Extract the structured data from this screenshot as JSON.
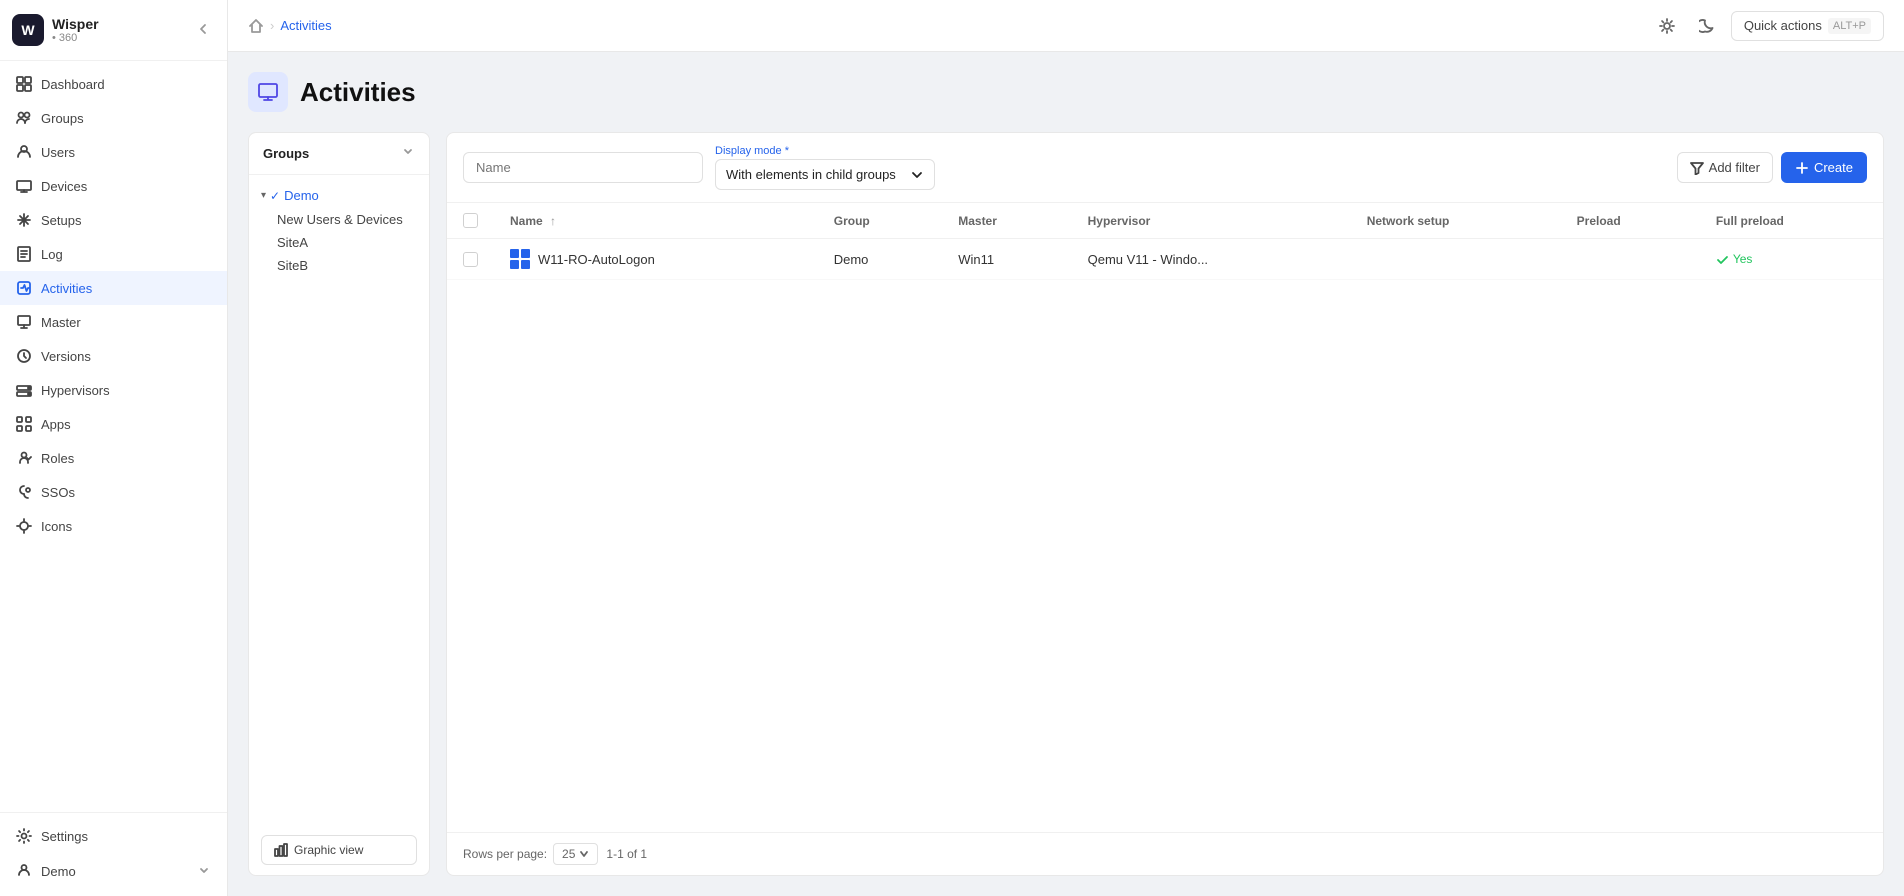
{
  "app": {
    "name": "Wisper",
    "version": "360"
  },
  "sidebar": {
    "items": [
      {
        "label": "Dashboard",
        "icon": "dashboard-icon",
        "active": false
      },
      {
        "label": "Groups",
        "icon": "groups-icon",
        "active": false
      },
      {
        "label": "Users",
        "icon": "users-icon",
        "active": false
      },
      {
        "label": "Devices",
        "icon": "devices-icon",
        "active": false
      },
      {
        "label": "Setups",
        "icon": "setups-icon",
        "active": false
      },
      {
        "label": "Log",
        "icon": "log-icon",
        "active": false
      },
      {
        "label": "Activities",
        "icon": "activities-icon",
        "active": true
      },
      {
        "label": "Master",
        "icon": "master-icon",
        "active": false
      },
      {
        "label": "Versions",
        "icon": "versions-icon",
        "active": false
      },
      {
        "label": "Hypervisors",
        "icon": "hypervisors-icon",
        "active": false
      },
      {
        "label": "Apps",
        "icon": "apps-icon",
        "active": false
      },
      {
        "label": "Roles",
        "icon": "roles-icon",
        "active": false
      },
      {
        "label": "SSOs",
        "icon": "ssos-icon",
        "active": false
      },
      {
        "label": "Icons",
        "icon": "icons-icon",
        "active": false
      }
    ],
    "bottom": [
      {
        "label": "Settings",
        "icon": "settings-icon"
      },
      {
        "label": "Demo",
        "icon": "user-icon"
      }
    ]
  },
  "topbar": {
    "breadcrumb_home": "home",
    "breadcrumb_separator": ">",
    "breadcrumb_current": "Activities",
    "quick_actions_label": "Quick actions",
    "quick_actions_shortcut": "ALT+P"
  },
  "page": {
    "title": "Activities",
    "icon": "monitor-icon"
  },
  "left_panel": {
    "title": "Groups",
    "items": [
      {
        "label": "Demo",
        "selected": true,
        "expanded": true
      },
      {
        "label": "New Users & Devices",
        "child": true
      },
      {
        "label": "SiteA",
        "child": true
      },
      {
        "label": "SiteB",
        "child": true
      }
    ],
    "graphic_view_label": "Graphic view"
  },
  "filter_bar": {
    "name_placeholder": "Name",
    "display_mode_label": "Display mode",
    "display_mode_required": "*",
    "display_mode_value": "With elements in child groups",
    "add_filter_label": "Add filter",
    "create_label": "Create"
  },
  "table": {
    "columns": [
      {
        "label": "Name",
        "sortable": true,
        "sort_dir": "asc"
      },
      {
        "label": "Group"
      },
      {
        "label": "Master"
      },
      {
        "label": "Hypervisor"
      },
      {
        "label": "Network setup"
      },
      {
        "label": "Preload"
      },
      {
        "label": "Full preload"
      }
    ],
    "rows": [
      {
        "name": "W11-RO-AutoLogon",
        "group": "Demo",
        "master": "Win11",
        "hypervisor": "Qemu V11 - Windo...",
        "network_setup": "",
        "preload": "",
        "full_preload": "Yes",
        "full_preload_checked": true
      }
    ],
    "rows_per_page_label": "Rows per page:",
    "rows_per_page_value": "25",
    "pagination": "1-1 of 1"
  }
}
